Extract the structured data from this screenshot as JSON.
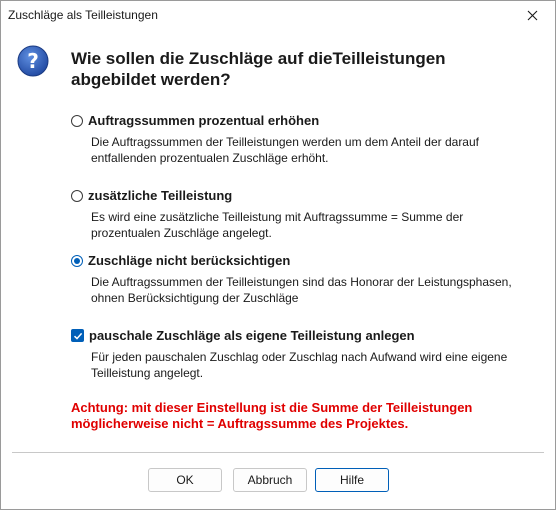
{
  "window": {
    "title": "Zuschläge als Teilleistungen"
  },
  "dialog": {
    "heading": "Wie sollen die Zuschläge auf dieTeilleistungen abgebildet werden?",
    "options": [
      {
        "label": "Auftragssummen prozentual erhöhen",
        "description": "Die Auftragssummen der Teilleistungen werden um dem Anteil der darauf entfallenden prozentualen Zuschläge erhöht.",
        "checked": false
      },
      {
        "label": "zusätzliche Teilleistung",
        "description": "Es wird eine zusätzliche Teilleistung mit Auftragssumme = Summe der prozentualen Zuschläge angelegt.",
        "checked": false
      },
      {
        "label": "Zuschläge nicht berücksichtigen",
        "description": "Die Auftragssummen der Teilleistungen sind das Honorar der Leistungsphasen, ohnen Berücksichtigung der Zuschläge",
        "checked": true
      }
    ],
    "checkbox": {
      "label": "pauschale Zuschläge als eigene Teilleistung anlegen",
      "description": "Für jeden pauschalen Zuschlag oder Zuschlag nach Aufwand wird eine eigene Teilleistung angelegt.",
      "checked": true
    },
    "warning": "Achtung: mit dieser Einstellung ist die Summe der Teilleistungen möglicherweise nicht = Auftragssumme des Projektes."
  },
  "buttons": {
    "ok": "OK",
    "cancel": "Abbruch",
    "help": "Hilfe"
  },
  "colors": {
    "accent": "#005fb8",
    "warning": "#e00000",
    "icon": "#2b57a8"
  },
  "icons": {
    "close": "close-icon",
    "question": "question-icon",
    "check": "checkmark-icon"
  }
}
